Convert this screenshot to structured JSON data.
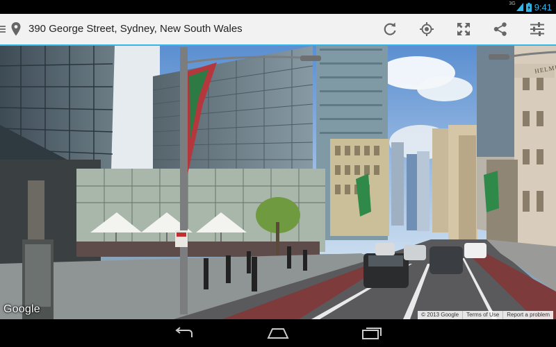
{
  "status_bar": {
    "network": "3G",
    "time": "9:41"
  },
  "action_bar": {
    "address": "390 George Street, Sydney, New South Wales",
    "actions": [
      "refresh-icon",
      "compass-mode-icon",
      "fullscreen-icon",
      "share-icon",
      "settings-sliders-icon"
    ]
  },
  "street_view": {
    "logo": "Google",
    "storefront": "HELMUT",
    "attribution": {
      "copyright": "© 2013 Google",
      "terms": "Terms of Use",
      "report": "Report a problem"
    }
  },
  "nav_bar": {
    "buttons": [
      "back-icon",
      "home-icon",
      "recent-apps-icon"
    ]
  },
  "colors": {
    "accent": "#33b5e5",
    "action_bar_bg": "#f2f2f2",
    "icon_gray": "#666666"
  }
}
